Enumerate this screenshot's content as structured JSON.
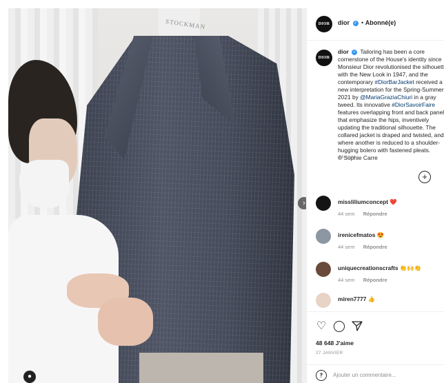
{
  "header": {
    "avatar_text": "DIOR",
    "username": "dior",
    "separator": "•",
    "follow_status": "Abonné(e)"
  },
  "caption": {
    "username": "dior",
    "text_1": "Tailoring has been a core cornerstone of the House's identity since Monsieur Dior revolutionised the silhouette with the New Look in 1947, and the contemporary",
    "hashtag_1": "#DiorBarJacket",
    "text_2": "received a new interpretation for the Spring-Summer 2021 by",
    "mention": "@MariaGraziaChiuri",
    "text_3": "in a gray tweed. Its innovative",
    "hashtag_2": "#DiorSavoirFaire",
    "text_4": "features overlapping front and back panels that emphasize the hips, inventively updating the traditional silhouette. The collared jacket is draped and twisted, and where another is reduced to a shoulder-hugging bolero with fastened pleats.",
    "credit": "© Sophie Carre",
    "time": "44 sem"
  },
  "photo": {
    "stand_label": "STOCKMAN",
    "next_icon": "chevron-right-icon",
    "tag_icon": "user-tag-icon"
  },
  "comments": [
    {
      "username": "missliliumconcept",
      "emoji": "❤️",
      "time": "44 sem",
      "reply": "Répondre",
      "avatar_color": "#141414"
    },
    {
      "username": "irenicefmatos",
      "emoji": "😍",
      "time": "44 sem",
      "reply": "Répondre",
      "avatar_color": "#8c97a3"
    },
    {
      "username": "uniquecreationscrafts",
      "emoji": "👏🙌👏",
      "time": "44 sem",
      "reply": "Répondre",
      "avatar_color": "#6a4a3a"
    },
    {
      "username": "miren7777",
      "emoji": "👍",
      "avatar_color": "#e8d3c6"
    }
  ],
  "actions": {
    "likes": "48 648 J'aime",
    "date": "27 JANVIER"
  },
  "add_comment": {
    "placeholder": "Ajouter un commentaire..."
  },
  "colors": {
    "link": "#00376b",
    "verified": "#3897f0",
    "muted": "#8e8e8e",
    "text": "#262626"
  }
}
